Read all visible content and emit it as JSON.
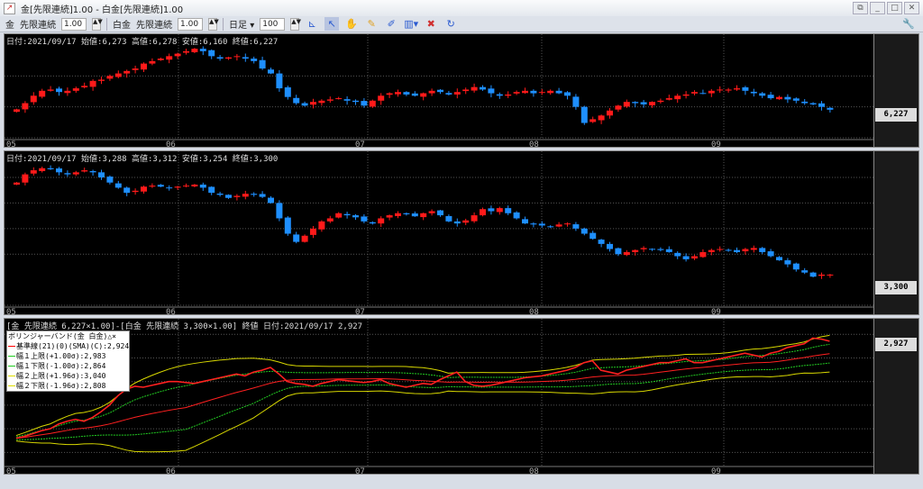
{
  "window": {
    "title": "金[先限連続]1.00 - 白金[先限連続]1.00",
    "minimize": "_",
    "maximize": "□",
    "close": "✕",
    "restore": "⧉"
  },
  "toolbar": {
    "symbol1": "金",
    "contract1": "先限連続",
    "mult1": "1.00",
    "symbol2": "白金",
    "contract2": "先限連続",
    "mult2": "1.00",
    "period": "日足",
    "period_arrow": "▾",
    "count": "100",
    "spin": "▲▼",
    "icons": [
      "chart-type-icon",
      "cursor-icon",
      "hand-icon",
      "pencil-icon",
      "draw-tool-icon",
      "bar-chart-icon",
      "delete-icon",
      "refresh-icon",
      "settings-icon"
    ]
  },
  "panels": [
    {
      "header": "日付:2021/09/17 始値:6,273 高値:6,278 安値:6,160 終値:6,227",
      "last": "6,227",
      "ticks": [
        "6,500",
        "6,250",
        "6,000"
      ]
    },
    {
      "header": "日付:2021/09/17 始値:3,288 高値:3,312 安値:3,254 終値:3,300",
      "last": "3,300",
      "ticks": [
        "4,250",
        "4,000",
        "3,750",
        "3,500",
        "3,000"
      ]
    },
    {
      "header": "[金 先限連続 6,227×1.00]-[白金 先限連続 3,300×1.00] 終値 日付:2021/09/17 2,927",
      "last": "2,927",
      "ticks": [
        "3,000",
        "2,750",
        "2,500",
        "2,250",
        "2,000",
        "1,750"
      ],
      "legend": {
        "title": "ボリンジャーバンド(金 白金)△×",
        "items": [
          "基準線(21)(0)(SMA)(C):2,924",
          "幅１上限(+1.00σ):2,983",
          "幅１下限(-1.00σ):2,864",
          "幅２上限(+1.96σ):3,040",
          "幅２下限(-1.96σ):2,808"
        ]
      }
    }
  ],
  "x_labels": [
    "05",
    "06",
    "07",
    "08",
    "09"
  ],
  "colors": {
    "up": "#ff1a1a",
    "down": "#1e8fff",
    "mid": "#ff2020",
    "band1": "#22cc22",
    "band2": "#d8d800"
  },
  "chart_data": [
    {
      "type": "candlestick",
      "name": "金 先限連続",
      "ylim": [
        6000,
        6750
      ],
      "close": [
        6230,
        6280,
        6340,
        6380,
        6390,
        6370,
        6380,
        6400,
        6420,
        6460,
        6470,
        6500,
        6520,
        6540,
        6560,
        6600,
        6620,
        6640,
        6660,
        6680,
        6700,
        6720,
        6700,
        6660,
        6640,
        6650,
        6660,
        6640,
        6620,
        6560,
        6520,
        6400,
        6330,
        6280,
        6260,
        6290,
        6300,
        6310,
        6320,
        6300,
        6290,
        6260,
        6300,
        6340,
        6360,
        6370,
        6350,
        6340,
        6360,
        6380,
        6370,
        6350,
        6370,
        6390,
        6410,
        6390,
        6360,
        6340,
        6350,
        6370,
        6380,
        6360,
        6370,
        6380,
        6360,
        6340,
        6250,
        6120,
        6150,
        6180,
        6220,
        6260,
        6290,
        6280,
        6270,
        6290,
        6300,
        6320,
        6340,
        6350,
        6370,
        6360,
        6380,
        6390,
        6390,
        6400,
        6380,
        6360,
        6340,
        6320,
        6330,
        6310,
        6300,
        6280,
        6270,
        6250,
        6227
      ]
    },
    {
      "type": "candlestick",
      "name": "白金 先限連続",
      "ylim": [
        3000,
        4400
      ],
      "close": [
        4200,
        4280,
        4320,
        4340,
        4330,
        4300,
        4280,
        4300,
        4320,
        4300,
        4250,
        4200,
        4150,
        4100,
        4120,
        4160,
        4170,
        4160,
        4150,
        4160,
        4170,
        4180,
        4150,
        4100,
        4080,
        4050,
        4070,
        4090,
        4080,
        4060,
        4000,
        3850,
        3700,
        3620,
        3680,
        3750,
        3820,
        3850,
        3900,
        3880,
        3860,
        3820,
        3800,
        3850,
        3880,
        3900,
        3890,
        3870,
        3900,
        3920,
        3880,
        3820,
        3800,
        3830,
        3880,
        3940,
        3920,
        3950,
        3900,
        3850,
        3800,
        3790,
        3780,
        3770,
        3790,
        3800,
        3750,
        3700,
        3650,
        3600,
        3550,
        3500,
        3520,
        3540,
        3560,
        3550,
        3540,
        3520,
        3480,
        3450,
        3480,
        3520,
        3540,
        3550,
        3540,
        3520,
        3550,
        3560,
        3520,
        3480,
        3440,
        3400,
        3350,
        3320,
        3280,
        3300,
        3300
      ]
    },
    {
      "type": "line",
      "name": "spread",
      "ylim": [
        1620,
        3050
      ],
      "values": [
        1900,
        1920,
        1950,
        1980,
        2000,
        2050,
        2080,
        2100,
        2080,
        2120,
        2180,
        2250,
        2350,
        2420,
        2450,
        2440,
        2460,
        2480,
        2500,
        2500,
        2490,
        2480,
        2500,
        2520,
        2540,
        2560,
        2580,
        2560,
        2600,
        2620,
        2650,
        2580,
        2500,
        2480,
        2470,
        2450,
        2480,
        2500,
        2520,
        2510,
        2500,
        2490,
        2500,
        2520,
        2480,
        2460,
        2440,
        2460,
        2480,
        2470,
        2520,
        2560,
        2600,
        2500,
        2460,
        2450,
        2460,
        2480,
        2500,
        2520,
        2540,
        2550,
        2560,
        2580,
        2600,
        2620,
        2650,
        2700,
        2720,
        2620,
        2600,
        2580,
        2620,
        2640,
        2660,
        2680,
        2700,
        2700,
        2720,
        2740,
        2700,
        2700,
        2720,
        2740,
        2760,
        2780,
        2800,
        2780,
        2760,
        2800,
        2820,
        2860,
        2880,
        2900,
        2960,
        2950,
        2927
      ]
    }
  ]
}
